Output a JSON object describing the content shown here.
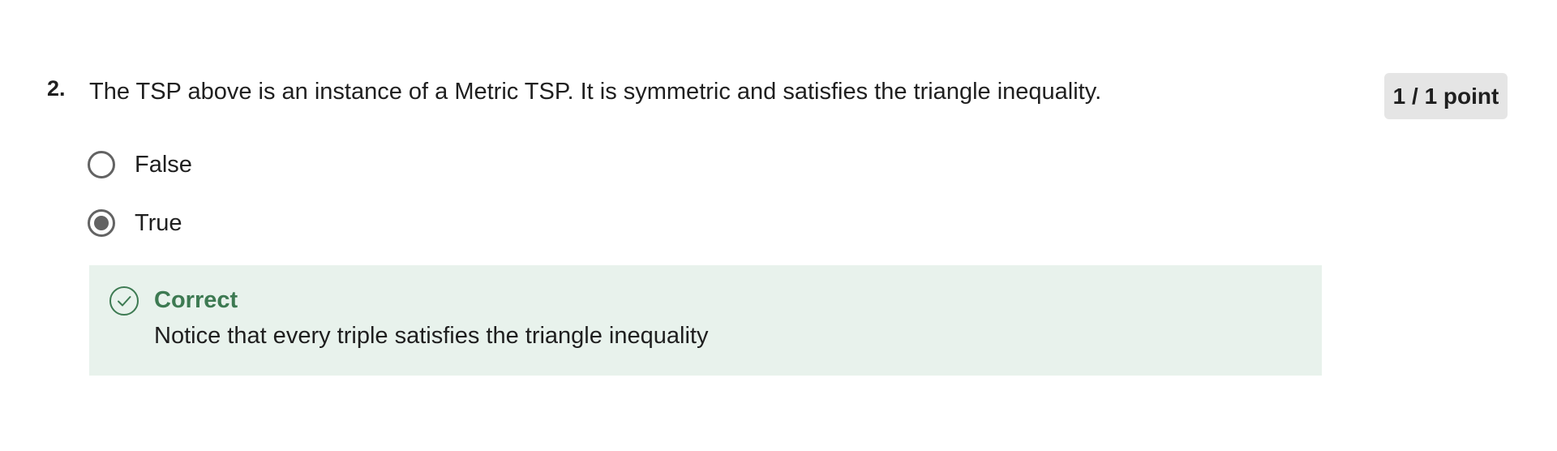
{
  "question": {
    "number": "2.",
    "text": "The TSP above is an instance of a Metric TSP. It is symmetric and satisfies the triangle inequality.",
    "points": "1 / 1 point",
    "options": [
      {
        "label": "False",
        "selected": false
      },
      {
        "label": "True",
        "selected": true
      }
    ]
  },
  "feedback": {
    "status": "Correct",
    "message": "Notice that every triple satisfies the triangle inequality",
    "icon": "check-circle-icon",
    "colors": {
      "accent": "#3d7a52",
      "background": "#e8f2ec"
    }
  }
}
